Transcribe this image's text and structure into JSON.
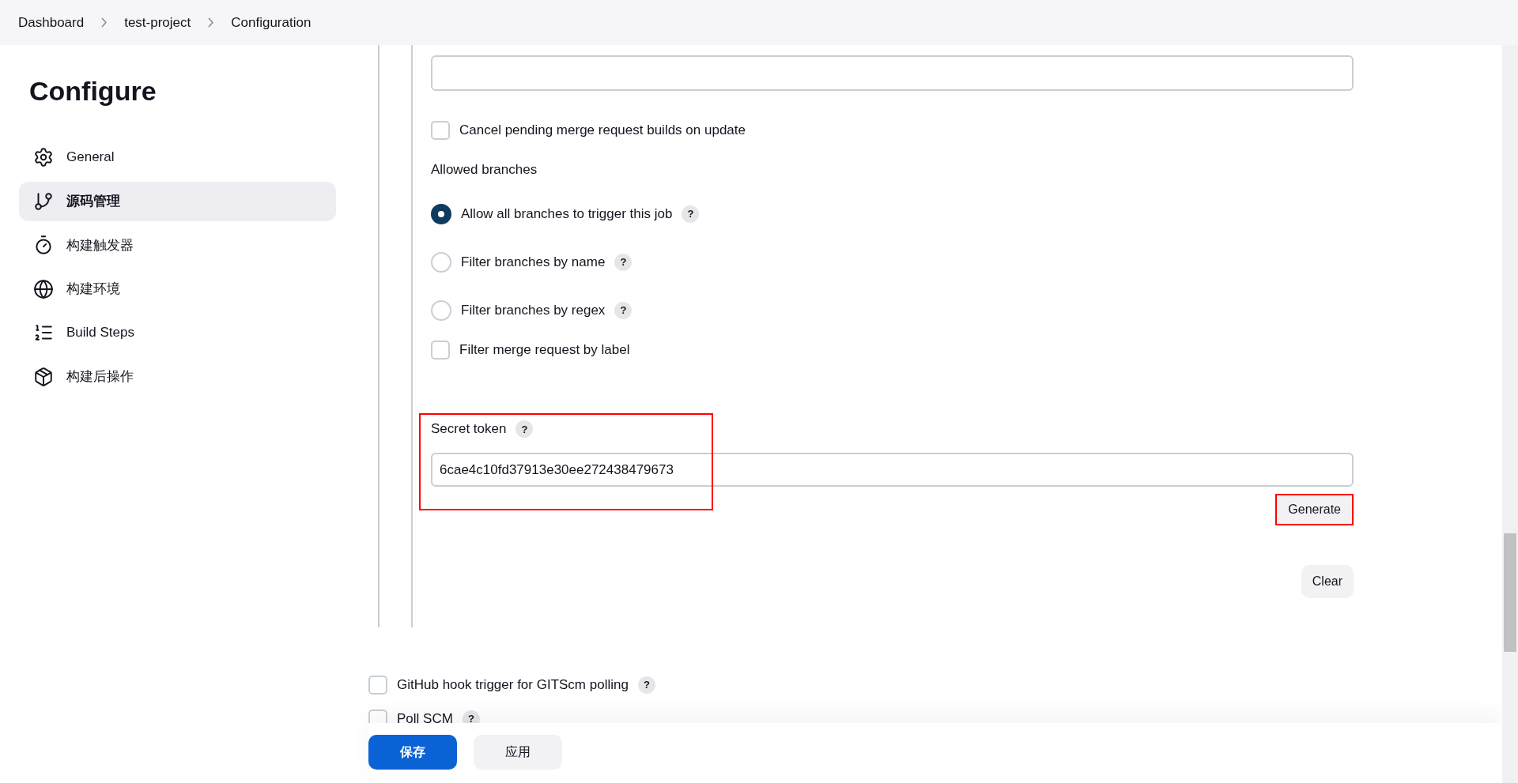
{
  "breadcrumbs": [
    {
      "label": "Dashboard"
    },
    {
      "label": "test-project"
    },
    {
      "label": "Configuration"
    }
  ],
  "sidebar": {
    "title": "Configure",
    "items": [
      {
        "label": "General",
        "kind": "gear",
        "selected": false
      },
      {
        "label": "源码管理",
        "kind": "branch",
        "selected": true
      },
      {
        "label": "构建触发器",
        "kind": "timer",
        "selected": false
      },
      {
        "label": "构建环境",
        "kind": "globe",
        "selected": false
      },
      {
        "label": "Build Steps",
        "kind": "list",
        "selected": false
      },
      {
        "label": "构建后操作",
        "kind": "package",
        "selected": false
      }
    ]
  },
  "cancel_pending": {
    "label": "Cancel pending merge request builds on update",
    "checked": false
  },
  "allowed_branches": {
    "label": "Allowed branches",
    "options": [
      {
        "label": "Allow all branches to trigger this job",
        "help": "?",
        "selected": true
      },
      {
        "label": "Filter branches by name",
        "help": "?",
        "selected": false
      },
      {
        "label": "Filter branches by regex",
        "help": "?",
        "selected": false
      }
    ]
  },
  "filter_by_label": {
    "label": "Filter merge request by label",
    "checked": false
  },
  "secret_token": {
    "label": "Secret token",
    "help": "?",
    "value": "6cae4c10fd37913e30ee272438479673",
    "highlighted": true
  },
  "generate_button": {
    "label": "Generate",
    "highlighted": true
  },
  "clear_button": {
    "label": "Clear"
  },
  "triggers": [
    {
      "label": "GitHub hook trigger for GITScm polling",
      "help": "?",
      "checked": false
    },
    {
      "label": "Poll SCM",
      "help": "?",
      "checked": false
    }
  ],
  "actions": [
    {
      "label": "保存",
      "kind": "primary"
    },
    {
      "label": "应用",
      "kind": "secondary"
    }
  ]
}
